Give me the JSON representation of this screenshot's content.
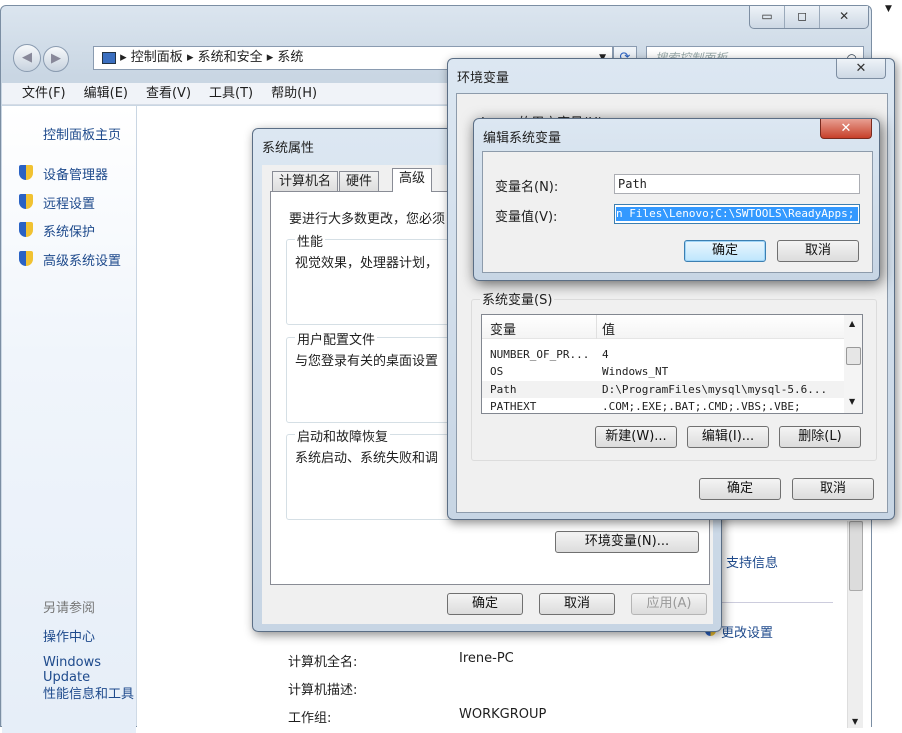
{
  "window": {
    "controls": {
      "minimize": "▭",
      "maximize": "◻",
      "close": "✕"
    },
    "breadcrumb": [
      "控制面板",
      "系统和安全",
      "系统"
    ],
    "search_placeholder": "搜索控制面板",
    "menu": [
      "文件(F)",
      "编辑(E)",
      "查看(V)",
      "工具(T)",
      "帮助(H)"
    ]
  },
  "sidebar": {
    "home": "控制面板主页",
    "tasks": [
      "设备管理器",
      "远程设置",
      "系统保护",
      "高级系统设置"
    ],
    "see_also_title": "另请参阅",
    "see_also": [
      "操作中心",
      "Windows Update",
      "性能信息和工具"
    ]
  },
  "main": {
    "support_link": "支持信息",
    "change_settings_link": "更改设置",
    "fields": [
      {
        "label": "计算机全名:",
        "value": "Irene-PC"
      },
      {
        "label": "计算机描述:",
        "value": ""
      },
      {
        "label": "工作组:",
        "value": "WORKGROUP"
      }
    ]
  },
  "sysprops": {
    "title": "系统属性",
    "tabs": [
      "计算机名",
      "硬件",
      "高级"
    ],
    "active_tab": "高级",
    "intro": "要进行大多数更改，您必须",
    "groups": [
      {
        "title": "性能",
        "desc": "视觉效果，处理器计划，"
      },
      {
        "title": "用户配置文件",
        "desc": "与您登录有关的桌面设置"
      },
      {
        "title": "启动和故障恢复",
        "desc": "系统启动、系统失败和调"
      }
    ],
    "env_button": "环境变量(N)...",
    "ok": "确定",
    "cancel": "取消",
    "apply": "应用(A)"
  },
  "envvars": {
    "title": "环境变量",
    "close": "✕",
    "user_vars_label": "Irene 的用户变量(U)",
    "system_vars_label": "系统变量(S)",
    "columns": [
      "变量",
      "值"
    ],
    "rows": [
      {
        "name": "NUMBER_OF_PR...",
        "value": "4"
      },
      {
        "name": "OS",
        "value": "Windows_NT"
      },
      {
        "name": "Path",
        "value": "D:\\ProgramFiles\\mysql\\mysql-5.6..."
      },
      {
        "name": "PATHEXT",
        "value": ".COM;.EXE;.BAT;.CMD;.VBS;.VBE;"
      }
    ],
    "new": "新建(W)...",
    "edit": "编辑(I)...",
    "delete": "删除(L)",
    "ok": "确定",
    "cancel": "取消"
  },
  "editvar": {
    "title": "编辑系统变量",
    "close": "✕",
    "name_label": "变量名(N):",
    "name_value": "Path",
    "value_label": "变量值(V):",
    "value_value": "n Files\\Lenovo;C:\\SWTOOLS\\ReadyApps;",
    "ok": "确定",
    "cancel": "取消"
  }
}
